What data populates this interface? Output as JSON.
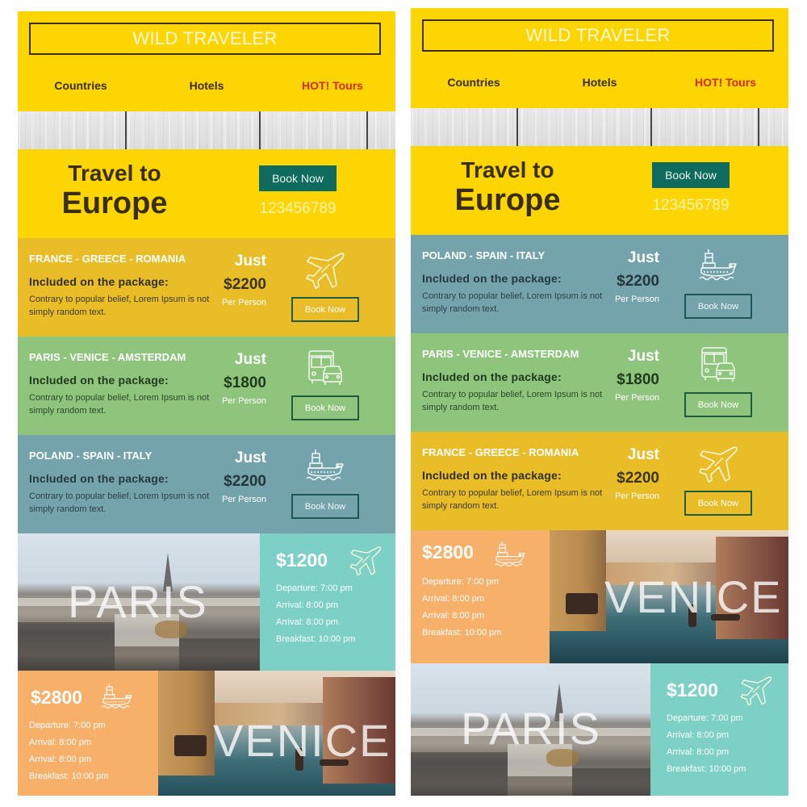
{
  "panels": [
    {
      "id": "left",
      "brand": "WILD TRAVELER",
      "nav": [
        "Countries",
        "Hotels",
        "HOT! Tours"
      ],
      "hero": {
        "title_line1": "Travel to",
        "title_line2": "Europe",
        "button_label": "Book Now",
        "phone": "123456789"
      },
      "tours": [
        {
          "route": "FRANCE - GREECE - ROMANIA",
          "included_label": "Included on the package:",
          "description": "Contrary to popular belief, Lorem Ipsum is not simply random text.",
          "just": "Just",
          "price": "$2200",
          "per": "Per Person",
          "button_label": "Book Now",
          "icon": "airplane-icon",
          "color": "#e9bd28"
        },
        {
          "route": "PARIS - VENICE - AMSTERDAM",
          "included_label": "Included on the package:",
          "description": "Contrary to popular belief, Lorem Ipsum is not simply random text.",
          "just": "Just",
          "price": "$1800",
          "per": "Per Person",
          "button_label": "Book Now",
          "icon": "bus-car-icon",
          "color": "#8fc47c"
        },
        {
          "route": "POLAND - SPAIN - ITALY",
          "included_label": "Included on the package:",
          "description": "Contrary to popular belief, Lorem Ipsum is not simply random text.",
          "just": "Just",
          "price": "$2200",
          "per": "Per Person",
          "button_label": "Book Now",
          "icon": "ship-icon",
          "color": "#74a3ab"
        }
      ],
      "destinations": [
        {
          "city": "PARIS",
          "price": "$1200",
          "icon": "airplane-icon",
          "lines": [
            "Departure: 7:00 pm",
            "Arrival: 8:00 pm",
            "Arrival: 8:00 pm",
            "Breakfast: 10:00 pm"
          ],
          "color": "#7dd0c6"
        },
        {
          "city": "VENICE",
          "price": "$2800",
          "icon": "ship-icon",
          "lines": [
            "Departure: 7:00 pm",
            "Arrival: 8:00 pm",
            "Arrival: 8:00 pm",
            "Breakfast: 10:00 pm"
          ],
          "color": "#f6b06a"
        }
      ]
    },
    {
      "id": "right",
      "brand": "WILD TRAVELER",
      "nav": [
        "Countries",
        "Hotels",
        "HOT! Tours"
      ],
      "hero": {
        "title_line1": "Travel to",
        "title_line2": "Europe",
        "button_label": "Book Now",
        "phone": "123456789"
      },
      "tours": [
        {
          "route": "POLAND - SPAIN - ITALY",
          "included_label": "Included on the package:",
          "description": "Contrary to popular belief, Lorem Ipsum is not simply random text.",
          "just": "Just",
          "price": "$2200",
          "per": "Per Person",
          "button_label": "Book Now",
          "icon": "ship-icon",
          "color": "#74a3ab"
        },
        {
          "route": "PARIS - VENICE - AMSTERDAM",
          "included_label": "Included on the package:",
          "description": "Contrary to popular belief, Lorem Ipsum is not simply random text.",
          "just": "Just",
          "price": "$1800",
          "per": "Per Person",
          "button_label": "Book Now",
          "icon": "bus-car-icon",
          "color": "#8fc47c"
        },
        {
          "route": "FRANCE - GREECE - ROMANIA",
          "included_label": "Included on the package:",
          "description": "Contrary to popular belief, Lorem Ipsum is not simply random text.",
          "just": "Just",
          "price": "$2200",
          "per": "Per Person",
          "button_label": "Book Now",
          "icon": "airplane-icon",
          "color": "#e9bd28"
        }
      ],
      "destinations": [
        {
          "city": "VENICE",
          "price": "$2800",
          "icon": "ship-icon",
          "lines": [
            "Departure: 7:00 pm",
            "Arrival: 8:00 pm",
            "Arrival: 8:00 pm",
            "Breakfast: 10:00 pm"
          ],
          "color": "#f6b06a"
        },
        {
          "city": "PARIS",
          "price": "$1200",
          "icon": "airplane-icon",
          "lines": [
            "Departure: 7:00 pm",
            "Arrival: 8:00 pm",
            "Arrival: 8:00 pm",
            "Breakfast: 10:00 pm"
          ],
          "color": "#7dd0c6"
        }
      ]
    }
  ],
  "colors": {
    "header_yellow": "#fdd502",
    "button_green": "#0e6b5d",
    "hot_red": "#d42a12"
  }
}
